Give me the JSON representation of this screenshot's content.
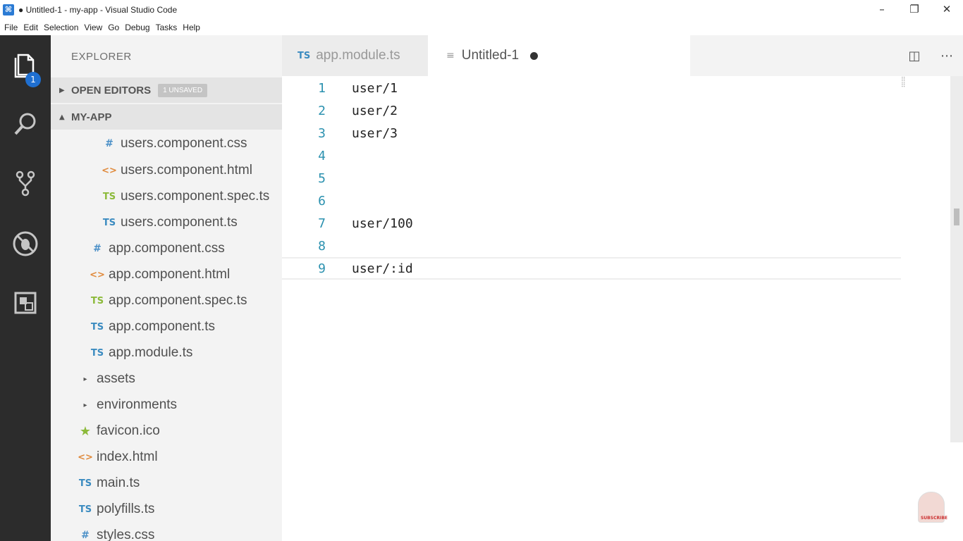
{
  "window": {
    "title": "● Untitled-1 - my-app - Visual Studio Code",
    "controls": [
      "–",
      "❐",
      "✕"
    ]
  },
  "menu": [
    "File",
    "Edit",
    "Selection",
    "View",
    "Go",
    "Debug",
    "Tasks",
    "Help"
  ],
  "activity_bar": {
    "items": [
      "explorer-icon",
      "search-icon",
      "source-control-icon",
      "debug-icon",
      "extensions-icon"
    ],
    "explorer_badge": "1"
  },
  "sidebar": {
    "title": "EXPLORER",
    "open_editors": {
      "label": "OPEN EDITORS",
      "badge": "1 UNSAVED"
    },
    "project": {
      "label": "MY-APP"
    },
    "files": [
      {
        "icon": "#",
        "type": "css",
        "name": "users.component.css"
      },
      {
        "icon": "<>",
        "type": "html",
        "name": "users.component.html"
      },
      {
        "icon": "TS",
        "type": "spec",
        "name": "users.component.spec.ts"
      },
      {
        "icon": "TS",
        "type": "ts",
        "name": "users.component.ts"
      },
      {
        "icon": "#",
        "type": "css",
        "name": "app.component.css"
      },
      {
        "icon": "<>",
        "type": "html",
        "name": "app.component.html"
      },
      {
        "icon": "TS",
        "type": "spec",
        "name": "app.component.spec.ts"
      },
      {
        "icon": "TS",
        "type": "ts",
        "name": "app.component.ts"
      },
      {
        "icon": "TS",
        "type": "ts",
        "name": "app.module.ts"
      },
      {
        "icon": "▸",
        "type": "folder",
        "name": "assets"
      },
      {
        "icon": "▸",
        "type": "folder",
        "name": "environments"
      },
      {
        "icon": "★",
        "type": "star",
        "name": "favicon.ico"
      },
      {
        "icon": "<>",
        "type": "html",
        "name": "index.html"
      },
      {
        "icon": "TS",
        "type": "ts",
        "name": "main.ts"
      },
      {
        "icon": "TS",
        "type": "ts",
        "name": "polyfills.ts"
      },
      {
        "icon": "#",
        "type": "css",
        "name": "styles.css"
      }
    ]
  },
  "tabs": [
    {
      "icon": "TS",
      "label": "app.module.ts",
      "active": false
    },
    {
      "icon": "≡",
      "label": "Untitled-1",
      "active": true,
      "dirty": true
    }
  ],
  "editor": {
    "lines": [
      {
        "num": "1",
        "text": "user/1"
      },
      {
        "num": "2",
        "text": "user/2"
      },
      {
        "num": "3",
        "text": "user/3"
      },
      {
        "num": "4",
        "text": ""
      },
      {
        "num": "5",
        "text": ""
      },
      {
        "num": "6",
        "text": ""
      },
      {
        "num": "7",
        "text": "user/100"
      },
      {
        "num": "8",
        "text": ""
      },
      {
        "num": "9",
        "text": "user/:id"
      }
    ],
    "current_line": "9"
  },
  "overlay": {
    "subscribe_text": "SUBSCRIBE"
  }
}
